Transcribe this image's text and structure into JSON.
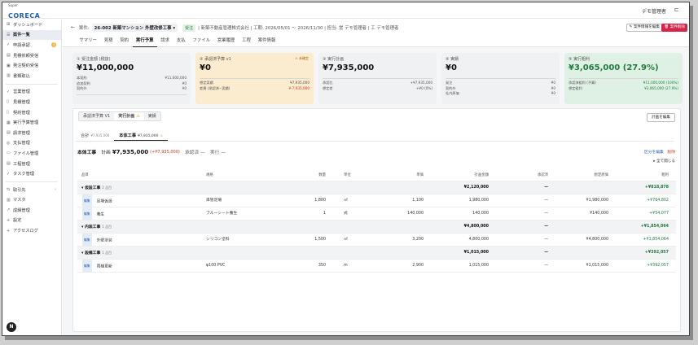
{
  "brand": {
    "super": "Super",
    "name": "CORECA"
  },
  "topbar": {
    "user": "デモ管理者",
    "icon": "layout-icon"
  },
  "sidebar": {
    "items": [
      {
        "icon": "dashboard-icon",
        "glyph": "⊞",
        "label": "ダッシュボード"
      },
      {
        "icon": "list-icon",
        "glyph": "☰",
        "label": "案件一覧",
        "active": true
      },
      {
        "icon": "check-icon",
        "glyph": "✓",
        "label": "申請承認",
        "badge": "3"
      },
      {
        "icon": "inbox-icon",
        "glyph": "▤",
        "label": "見積依頼受信"
      },
      {
        "icon": "order-icon",
        "glyph": "▣",
        "label": "発注契約受信"
      },
      {
        "icon": "book-icon",
        "glyph": "▥",
        "label": "書類取込"
      },
      {
        "sep": true
      },
      {
        "icon": "check-icon",
        "glyph": "✓",
        "label": "営業管理"
      },
      {
        "icon": "doc-icon",
        "glyph": "▯",
        "label": "見積管理"
      },
      {
        "icon": "contract-icon",
        "glyph": "▯",
        "label": "契約管理"
      },
      {
        "icon": "budget-icon",
        "glyph": "▦",
        "label": "実行予算管理"
      },
      {
        "icon": "invoice-icon",
        "glyph": "▤",
        "label": "請求管理"
      },
      {
        "icon": "payment-icon",
        "glyph": "◎",
        "label": "支払管理"
      },
      {
        "icon": "folder-icon",
        "glyph": "▭",
        "label": "ファイル管理"
      },
      {
        "icon": "schedule-icon",
        "glyph": "▤",
        "label": "工程管理"
      },
      {
        "icon": "task-icon",
        "glyph": "✓",
        "label": "タスク管理"
      },
      {
        "sep": true
      },
      {
        "icon": "partner-icon",
        "glyph": "⇆",
        "label": "取引先",
        "chev": "›"
      },
      {
        "icon": "master-icon",
        "glyph": "▥",
        "label": "マスタ"
      },
      {
        "icon": "growth-icon",
        "glyph": "↗",
        "label": "成績管理"
      },
      {
        "icon": "plus-icon",
        "glyph": "+",
        "label": "設定"
      },
      {
        "icon": "plus-icon",
        "glyph": "+",
        "label": "アクセスログ"
      }
    ],
    "logo": "N"
  },
  "header": {
    "back": "←",
    "case_label": "案件:",
    "case_no": "26-002",
    "case_name": "新築マンション 外壁改修工事",
    "case_caret": "▾",
    "status": "受注",
    "info": "| 新築不動産管理株式会社 | 工期: 2026/05/01 ～ 2026/11/30 | 担当: 営 デモ管理者 | 工 デモ管理者",
    "edit_btn": "✎ 案件情報を編集",
    "delete_btn": "🗑 案件削除",
    "tabs": [
      "サマリー",
      "見積",
      "契約",
      "実行予算",
      "請求",
      "支払",
      "ファイル",
      "営業履歴",
      "工程",
      "案件情報"
    ],
    "active_tab": 3
  },
  "cards": [
    {
      "title": "① 受注金額 (税抜)",
      "value": "¥11,000,000",
      "rows_top": [
        [
          "本契約",
          "¥11,000,000"
        ],
        [
          "追加契約",
          "¥0"
        ],
        [
          "契約外",
          "¥0"
        ]
      ],
      "rows_bottom": []
    },
    {
      "title": "② 承認済予算 v1",
      "warn": "⚠ 未確定",
      "value": "¥0",
      "rows_top": [],
      "rows_bottom": [
        [
          "想定実績",
          "¥7,935,000"
        ],
        [
          "差異 (承認済−実績)",
          "¥-7,935,000",
          "red"
        ]
      ]
    },
    {
      "title": "③ 実行計画",
      "value": "¥7,935,000",
      "rows_top": [],
      "rows_bottom": [
        [
          "承認比",
          "+¥7,935,000"
        ],
        [
          "想定差",
          "+¥0 (0%)"
        ]
      ]
    },
    {
      "title": "④ 実績",
      "value": "¥0",
      "rows_top": [],
      "rows_bottom": [
        [
          "発注",
          "¥0"
        ],
        [
          "契約外",
          "¥0"
        ],
        [
          "社内原価",
          "¥0"
        ]
      ]
    },
    {
      "title": "⑤ 実行粗利",
      "value": "¥3,065,000 (27.9%)",
      "green": true,
      "rows_top": [],
      "rows_bottom": [
        [
          "承認済粗利 (予算)",
          "¥11,000,000 (100%)",
          "grn"
        ],
        [
          "想定粗利",
          "¥3,065,000 (27.9%)",
          "grn"
        ]
      ]
    }
  ],
  "panel": {
    "segments": [
      {
        "label": "承認済予算 V1"
      },
      {
        "label": "実行計画",
        "warn": "⚠",
        "active": true
      },
      {
        "label": "実績"
      }
    ],
    "plan_btn": "計画を編集",
    "ptabs": [
      {
        "label": "合計",
        "sub": "¥7,935,000"
      },
      {
        "label": "本体工事",
        "sub": "¥7,935,000",
        "warn": "⚠",
        "active": true
      }
    ],
    "section": {
      "title": "本体工事",
      "plan_label": "計画",
      "plan_value": "¥7,935,000",
      "plan_diff": "(+¥7,935,000)",
      "approved": "承認済 —",
      "actual": "実行 —",
      "edit": "区分を編集",
      "delete": "削除",
      "toggle": "▸ 全て開じる"
    },
    "columns": [
      "品目",
      "規格",
      "数量",
      "単位",
      "単価",
      "計画金額",
      "承認済",
      "想定原価",
      "粗利"
    ],
    "rows": [
      {
        "type": "group",
        "name": "▾ 仮設工事",
        "count": "2 品目",
        "amount": "¥2,120,000",
        "approved": "—",
        "profit": "+¥818,878"
      },
      {
        "type": "item",
        "tag": "編集",
        "name": "足場仮設",
        "spec": "単管足場",
        "qty": "1,800",
        "unit": "㎡",
        "price": "1,100",
        "amount": "1,980,000",
        "approved": "—",
        "cost": "¥1,980,000",
        "profit": "+¥764,802"
      },
      {
        "type": "item",
        "tag": "編集",
        "name": "養生",
        "spec": "ブルーシート養生",
        "qty": "1",
        "unit": "式",
        "price": "140,000",
        "amount": "140,000",
        "approved": "—",
        "cost": "¥140,000",
        "profit": "+¥54,077"
      },
      {
        "type": "group",
        "name": "▾ 内装工事",
        "count": "1 品目",
        "amount": "¥4,800,000",
        "approved": "—",
        "profit": "+¥1,854,064"
      },
      {
        "type": "item",
        "tag": "編集",
        "name": "外壁塗装",
        "spec": "シリコン塗料",
        "qty": "1,500",
        "unit": "㎡",
        "price": "3,200",
        "amount": "4,800,000",
        "approved": "—",
        "cost": "¥4,800,000",
        "profit": "+¥1,854,064"
      },
      {
        "type": "group",
        "name": "▾ 設備工事",
        "count": "1 品目",
        "amount": "¥1,015,000",
        "approved": "—",
        "profit": "+¥392,057"
      },
      {
        "type": "item",
        "tag": "編集",
        "name": "雨樋更新",
        "spec": "φ100 PVC",
        "qty": "350",
        "unit": "m",
        "price": "2,900",
        "amount": "1,015,000",
        "approved": "—",
        "cost": "¥1,015,000",
        "profit": "+¥392,057"
      }
    ]
  }
}
